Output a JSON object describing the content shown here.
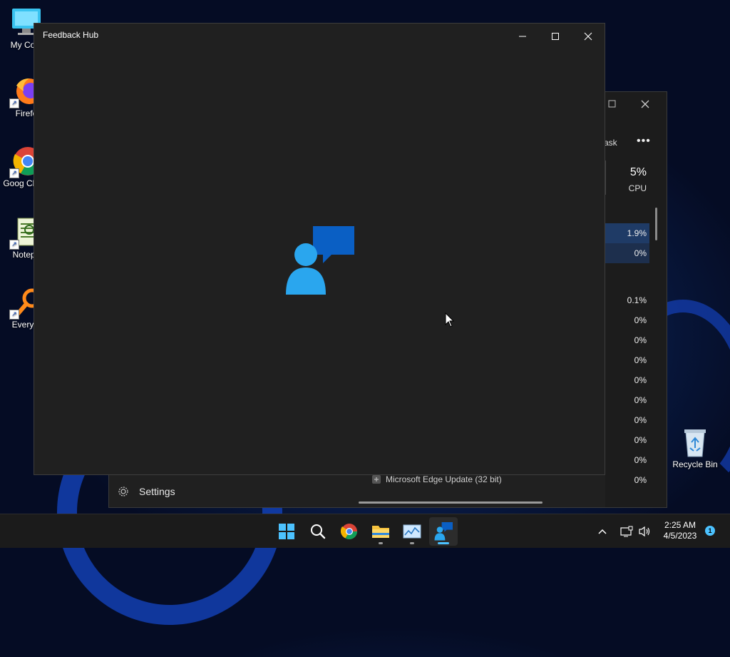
{
  "desktop": {
    "icons": [
      {
        "label": "My Com",
        "icon": "monitor-icon"
      },
      {
        "label": "Firefo",
        "icon": "firefox-icon"
      },
      {
        "label": "Goog Chron",
        "icon": "chrome-icon"
      },
      {
        "label": "Notepa",
        "icon": "notepad-icon"
      },
      {
        "label": "Everyth",
        "icon": "search-app-icon"
      },
      {
        "label": "Recycle Bin",
        "icon": "recycle-bin-icon"
      }
    ]
  },
  "task_manager": {
    "end_task_label": "ask",
    "more_label": "•••",
    "cpu_percent": "5%",
    "cpu_label": "CPU",
    "rows": [
      "1.9%",
      "0%",
      "0.1%",
      "0%",
      "0%",
      "0%",
      "0%",
      "0%",
      "0%",
      "0%",
      "0%",
      "0%"
    ],
    "settings_label": "Settings",
    "process_label": "Microsoft Edge Update (32 bit)"
  },
  "feedback_hub": {
    "title": "Feedback Hub",
    "accent": "#1e9bf0"
  },
  "taskbar": {
    "apps": [
      "windows-start-icon",
      "search-icon",
      "chrome-icon",
      "file-explorer-icon",
      "task-manager-icon",
      "feedback-hub-icon"
    ],
    "clock_time": "2:25 AM",
    "clock_date": "4/5/2023",
    "notification_count": "1"
  }
}
